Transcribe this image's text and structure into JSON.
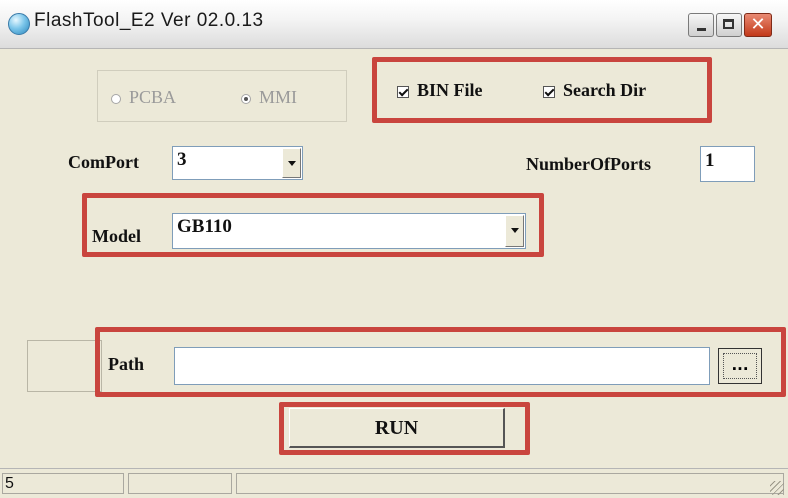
{
  "window": {
    "title": "FlashTool_E2  Ver 02.0.13",
    "controls": {
      "minimize_icon": "minimize-icon",
      "maximize_icon": "maximize-icon",
      "close_glyph": "✕"
    }
  },
  "mode": {
    "options": [
      {
        "label": "PCBA",
        "selected": false
      },
      {
        "label": "MMI",
        "selected": true
      }
    ]
  },
  "options": {
    "bin_file": {
      "label": "BIN File",
      "checked": true
    },
    "search_dir": {
      "label": "Search Dir",
      "checked": true
    }
  },
  "comport": {
    "label": "ComPort",
    "value": "3"
  },
  "number_of_ports": {
    "label": "NumberOfPorts",
    "value": "1"
  },
  "model": {
    "label": "Model",
    "value": "GB110"
  },
  "path": {
    "label": "Path",
    "value": "",
    "browse_label": "..."
  },
  "run": {
    "label": "RUN"
  },
  "status": {
    "cells": [
      "5",
      "",
      ""
    ]
  },
  "highlight_color": "#c9453e"
}
